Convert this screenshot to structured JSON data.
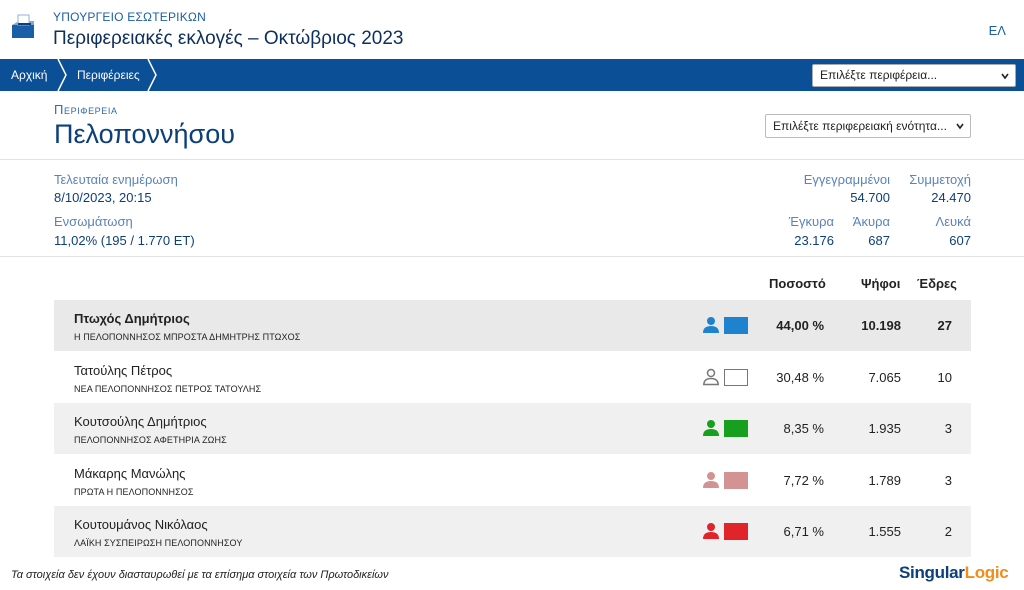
{
  "header": {
    "ministry": "ΥΠΟΥΡΓΕΙΟ ΕΣΩΤΕΡΙΚΩΝ",
    "title": "Περιφερειακές εκλογές – Οκτώβριος 2023",
    "language": "ΕΛ"
  },
  "nav": {
    "home": "Αρχική",
    "regions": "Περιφέρειες",
    "region_select_placeholder": "Επιλέξτε περιφέρεια..."
  },
  "region": {
    "label": "Περιφερεια",
    "name": "Πελοποννήσου",
    "unit_select_placeholder": "Επιλέξτε περιφερειακή ενότητα..."
  },
  "stats": {
    "last_update_label": "Τελευταία ενημέρωση",
    "last_update_value": "8/10/2023, 20:15",
    "integration_label": "Ενσωμάτωση",
    "integration_value": "11,02% (195 / 1.770 ΕΤ)",
    "registered_label": "Εγγεγραμμένοι",
    "registered_value": "54.700",
    "turnout_label": "Συμμετοχή",
    "turnout_value": "24.470",
    "valid_label": "Έγκυρα",
    "valid_value": "23.176",
    "invalid_label": "Άκυρα",
    "invalid_value": "687",
    "blank_label": "Λευκά",
    "blank_value": "607"
  },
  "table": {
    "headers": {
      "percentage": "Ποσοστό",
      "votes": "Ψήφοι",
      "seats": "Έδρες"
    },
    "rows": [
      {
        "candidate": "Πτωχός Δημήτριος",
        "party": "Η ΠΕΛΟΠΟΝΝΗΣΟΣ ΜΠΡΟΣΤΑ ΔΗΜΗΤΡΗΣ ΠΤΩΧΟΣ",
        "color": "#1f82cf",
        "percentage": "44,00 %",
        "votes": "10.198",
        "seats": "27"
      },
      {
        "candidate": "Τατούλης Πέτρος",
        "party": "ΝΕΑ ΠΕΛΟΠΟΝΝΗΣΟΣ ΠΕΤΡΟΣ ΤΑΤΟΥΛΗΣ",
        "color": "#ffffff",
        "percentage": "30,48 %",
        "votes": "7.065",
        "seats": "10"
      },
      {
        "candidate": "Κουτσούλης Δημήτριος",
        "party": "ΠΕΛΟΠΟΝΝΗΣΟΣ ΑΦΕΤΗΡΙΑ ΖΩΗΣ",
        "color": "#16a01e",
        "percentage": "8,35 %",
        "votes": "1.935",
        "seats": "3"
      },
      {
        "candidate": "Μάκαρης Μανώλης",
        "party": "ΠΡΩΤΑ Η ΠΕΛΟΠΟΝΝΗΣΟΣ",
        "color": "#d39393",
        "percentage": "7,72 %",
        "votes": "1.789",
        "seats": "3"
      },
      {
        "candidate": "Κουτουμάνος Νικόλαος",
        "party": "ΛΑΪΚΗ ΣΥΣΠΕΙΡΩΣΗ ΠΕΛΟΠΟΝΝΗΣΟΥ",
        "color": "#e0242a",
        "percentage": "6,71 %",
        "votes": "1.555",
        "seats": "2"
      }
    ]
  },
  "footer": {
    "note": "Τα στοιχεία δεν έχουν διασταυρωθεί με τα επίσημα στοιχεία των Πρωτοδικείων",
    "brand_main": "Singular",
    "brand_accent": "Logic"
  }
}
